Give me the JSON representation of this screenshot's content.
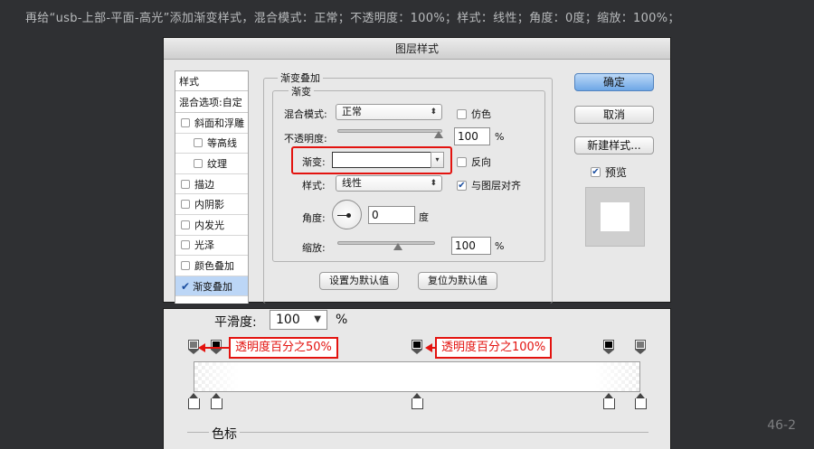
{
  "caption": "再给“usb-上部-平面-高光”添加渐变样式，混合模式：正常；不透明度：100%；样式：线性；角度：0度；缩放：100%；",
  "dialog": {
    "title": "图层样式",
    "left_panel": {
      "header": "样式",
      "blend_options": "混合选项:自定",
      "items": [
        {
          "label": "斜面和浮雕",
          "checked": false
        },
        {
          "label": "等高线",
          "checked": false
        },
        {
          "label": "纹理",
          "checked": false
        },
        {
          "label": "描边",
          "checked": false
        },
        {
          "label": "内阴影",
          "checked": false
        },
        {
          "label": "内发光",
          "checked": false
        },
        {
          "label": "光泽",
          "checked": false
        },
        {
          "label": "颜色叠加",
          "checked": false
        },
        {
          "label": "渐变叠加",
          "checked": true
        }
      ]
    },
    "section_title": "渐变叠加",
    "group_title": "渐变",
    "blend_mode_label": "混合模式:",
    "blend_mode_value": "正常",
    "dither_label": "仿色",
    "opacity_label": "不透明度:",
    "opacity_value": "100",
    "percent": "%",
    "gradient_label": "渐变:",
    "reverse_label": "反向",
    "style_label": "样式:",
    "style_value": "线性",
    "align_label": "与图层对齐",
    "angle_label": "角度:",
    "angle_value": "0",
    "degree": "度",
    "scale_label": "缩放:",
    "scale_value": "100",
    "set_default_btn": "设置为默认值",
    "reset_default_btn": "复位为默认值",
    "ok_btn": "确定",
    "cancel_btn": "取消",
    "new_style_btn": "新建样式...",
    "preview_label": "预览",
    "dither_checked": false,
    "reverse_checked": false,
    "align_checked": true,
    "preview_checked": true,
    "opacity_slider": 1.0,
    "scale_slider": 0.5
  },
  "gradient_editor": {
    "smoothness_label": "平滑度:",
    "smoothness_value": "100",
    "percent": "%",
    "color_stops_label": "色标",
    "callout_left": "透明度百分之50%",
    "callout_mid": "透明度百分之100%",
    "opacity_stops": [
      0.0,
      0.05,
      0.5,
      0.93,
      1.0
    ],
    "color_stops": [
      0.0,
      0.05,
      0.5,
      0.93,
      1.0
    ]
  },
  "page_number": "46-2",
  "colors": {
    "accent_red": "#e3130f",
    "selected_row": "#bcd6f6",
    "primary_button": "#6ea7e6"
  }
}
